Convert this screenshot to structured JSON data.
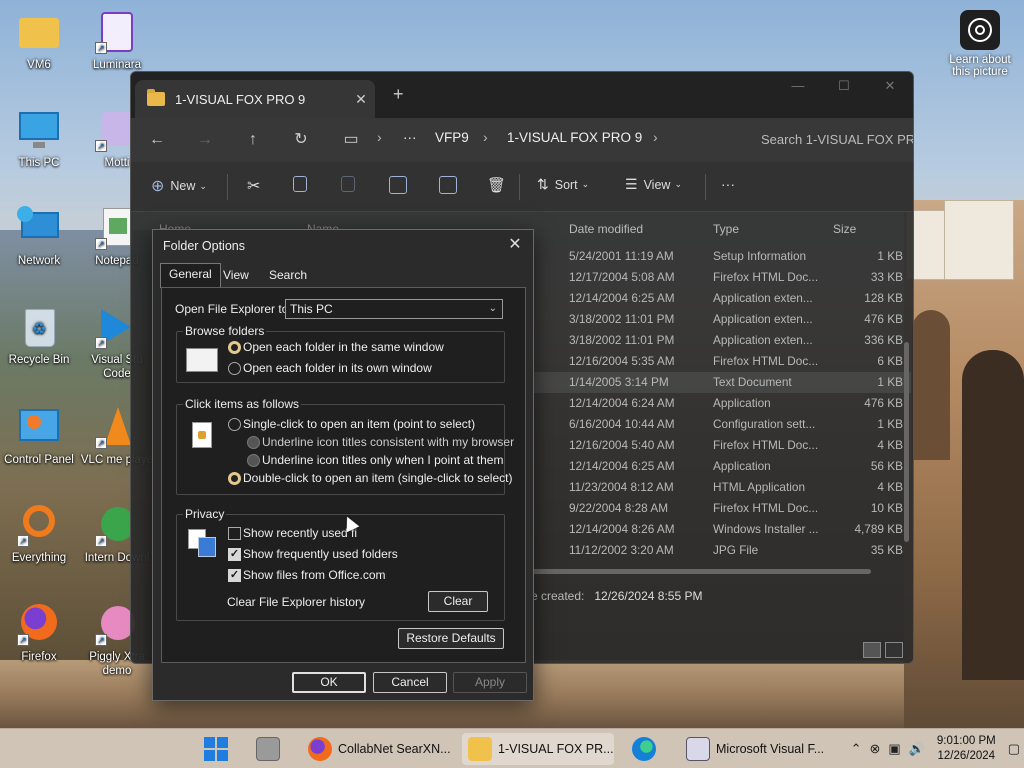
{
  "desktop": {
    "icons": [
      {
        "label": "VM6",
        "icon": "folder-icon"
      },
      {
        "label": "Luminara",
        "icon": "app-icon"
      },
      {
        "label": "This PC",
        "icon": "monitor-icon"
      },
      {
        "label": "Motti",
        "icon": "app-icon"
      },
      {
        "label": "Network",
        "icon": "network-icon"
      },
      {
        "label": "Notepad",
        "icon": "notepad-icon"
      },
      {
        "label": "Recycle Bin",
        "icon": "recycle-bin-icon"
      },
      {
        "label": "Visual Stu Code",
        "icon": "vscode-icon"
      },
      {
        "label": "Control Panel",
        "icon": "control-panel-icon"
      },
      {
        "label": "VLC me playe",
        "icon": "vlc-icon"
      },
      {
        "label": "Everything",
        "icon": "search-app-icon"
      },
      {
        "label": "Intern Downl",
        "icon": "download-manager-icon"
      },
      {
        "label": "Firefox",
        "icon": "firefox-icon"
      },
      {
        "label": "Piggly Xtra demo",
        "icon": "app-icon"
      }
    ],
    "learn": "Learn about this picture"
  },
  "explorer": {
    "tab_title": "1-VISUAL FOX PRO 9",
    "tab_close": "✕",
    "new_tab": "+",
    "breadcrumbs": [
      "VFP9",
      "1-VISUAL FOX PRO 9"
    ],
    "ellipsis": "···",
    "search_placeholder": "Search 1-VISUAL FOX PRO 9",
    "toolbar": {
      "new": "New",
      "sort": "Sort",
      "view": "View",
      "more": "···"
    },
    "columns": {
      "name": "Name",
      "date": "Date modified",
      "type": "Type",
      "size": "Size"
    },
    "nav_home": "Home",
    "files": [
      {
        "date": "5/24/2001 11:19 AM",
        "type": "Setup Information",
        "size": "1 KB"
      },
      {
        "date": "12/17/2004 5:08 AM",
        "type": "Firefox HTML Doc...",
        "size": "33 KB"
      },
      {
        "date": "12/14/2004 6:25 AM",
        "type": "Application exten...",
        "size": "128 KB"
      },
      {
        "date": "3/18/2002 11:01 PM",
        "type": "Application exten...",
        "size": "476 KB"
      },
      {
        "date": "3/18/2002 11:01 PM",
        "type": "Application exten...",
        "size": "336 KB"
      },
      {
        "date": "12/16/2004 5:35 AM",
        "type": "Firefox HTML Doc...",
        "size": "6 KB"
      },
      {
        "date": "1/14/2005 3:14 PM",
        "type": "Text Document",
        "size": "1 KB"
      },
      {
        "date": "12/14/2004 6:24 AM",
        "type": "Application",
        "size": "476 KB"
      },
      {
        "date": "6/16/2004 10:44 AM",
        "type": "Configuration sett...",
        "size": "1 KB"
      },
      {
        "date": "12/16/2004 5:40 AM",
        "type": "Firefox HTML Doc...",
        "size": "4 KB"
      },
      {
        "date": "12/14/2004 6:25 AM",
        "type": "Application",
        "size": "56 KB"
      },
      {
        "date": "11/23/2004 8:12 AM",
        "type": "HTML Application",
        "size": "4 KB"
      },
      {
        "date": "9/22/2004 8:28 AM",
        "type": "Firefox HTML Doc...",
        "size": "10 KB"
      },
      {
        "date": "12/14/2004 8:26 AM",
        "type": "Windows Installer ...",
        "size": "4,789 KB"
      },
      {
        "date": "11/12/2002 3:20 AM",
        "type": "JPG File",
        "size": "35 KB"
      }
    ],
    "status_label": "e created:",
    "status_value": "12/26/2024 8:55 PM",
    "selected_row_index": 6
  },
  "dialog": {
    "title": "Folder Options",
    "close": "✕",
    "tabs": [
      "General",
      "View",
      "Search"
    ],
    "active_tab": "General",
    "open_to_label": "Open File Explorer to:",
    "open_to_value": "This PC",
    "browse": {
      "legend": "Browse folders",
      "opt_same": "Open each folder in the same window",
      "opt_own": "Open each folder in its own window",
      "selected": "same"
    },
    "click": {
      "legend": "Click items as follows",
      "opt_single": "Single-click to open an item (point to select)",
      "sub_browser": "Underline icon titles consistent with my browser",
      "sub_point": "Underline icon titles only when I point at them",
      "opt_double": "Double-click to open an item (single-click to select)",
      "selected": "double"
    },
    "privacy": {
      "legend": "Privacy",
      "recent": "Show recently used fi",
      "recent_checked": false,
      "frequent": "Show frequently used folders",
      "frequent_checked": true,
      "office": "Show files from Office.com",
      "office_checked": true,
      "clear_label": "Clear File Explorer history",
      "clear_button": "Clear"
    },
    "restore_button": "Restore Defaults",
    "ok_button": "OK",
    "cancel_button": "Cancel",
    "apply_button": "Apply"
  },
  "taskbar": {
    "items": [
      {
        "label": "CollabNet SearXN...",
        "icon": "firefox-icon"
      },
      {
        "label": "1-VISUAL FOX PR...",
        "icon": "folder-icon",
        "active": true
      },
      {
        "label": "Microsoft Visual F...",
        "icon": "vfp-icon"
      }
    ],
    "time": "9:01:00 PM",
    "date": "12/26/2024"
  }
}
